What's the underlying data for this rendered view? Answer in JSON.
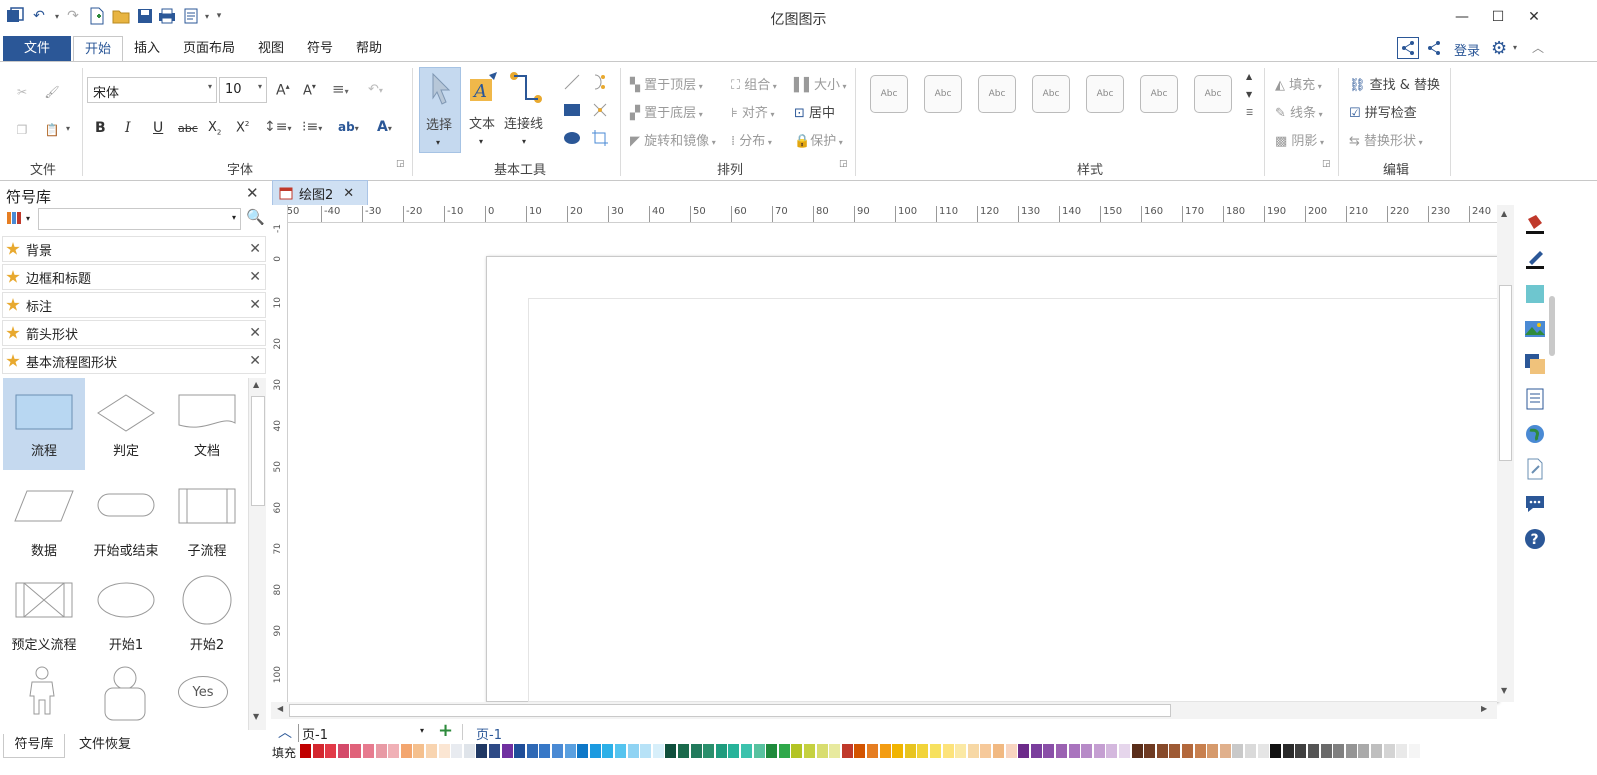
{
  "app": {
    "title": "亿图图示"
  },
  "ribbon_tabs": [
    "文件",
    "开始",
    "插入",
    "页面布局",
    "视图",
    "符号",
    "帮助"
  ],
  "account": {
    "login": "登录"
  },
  "ribbon": {
    "file_group": "文件",
    "font": {
      "family": "宋体",
      "size": "10",
      "group": "字体"
    },
    "tools": {
      "select": "选择",
      "text": "文本",
      "connector": "连接线",
      "group": "基本工具"
    },
    "arrange": {
      "bring_front": "置于顶层",
      "send_back": "置于底层",
      "rotate": "旋转和镜像",
      "group_btn": "组合",
      "align": "对齐",
      "distribute": "分布",
      "size": "大小",
      "center": "居中",
      "protect": "保护",
      "group": "排列"
    },
    "styles": {
      "thumb": "Abc",
      "fill": "填充",
      "line": "线条",
      "shadow": "阴影",
      "group": "样式"
    },
    "edit": {
      "find": "查找 & 替换",
      "spell": "拼写检查",
      "replace": "替换形状",
      "group": "编辑"
    }
  },
  "library": {
    "title": "符号库",
    "categories": [
      "背景",
      "边框和标题",
      "标注",
      "箭头形状",
      "基本流程图形状"
    ],
    "shapes": [
      "流程",
      "判定",
      "文档",
      "数据",
      "开始或结束",
      "子流程",
      "预定义流程",
      "开始1",
      "开始2"
    ],
    "yes_label": "Yes"
  },
  "bottom_tabs": [
    "符号库",
    "文件恢复"
  ],
  "document": {
    "tab": "绘图2"
  },
  "ruler": {
    "top": [
      "-50",
      "-40",
      "-30",
      "-20",
      "-10",
      "0",
      "10",
      "20",
      "30",
      "40",
      "50",
      "60",
      "70",
      "80",
      "90",
      "100",
      "110",
      "120",
      "130",
      "140",
      "150",
      "160",
      "170",
      "180",
      "190",
      "200",
      "210",
      "220",
      "230",
      "240"
    ],
    "left": [
      "-1",
      "0",
      "10",
      "20",
      "30",
      "40",
      "50",
      "60",
      "70",
      "80",
      "90",
      "100"
    ]
  },
  "pages": {
    "current": "页-1",
    "tab": "页-1"
  },
  "fill_label": "填充",
  "palette": [
    "#c00000",
    "#d4272f",
    "#e23a48",
    "#d44a6a",
    "#e0627a",
    "#e77b8f",
    "#e89aa5",
    "#f0b0b6",
    "#f3a66f",
    "#f5c08e",
    "#f8d4b0",
    "#fbe6d3",
    "#e8ebf0",
    "#dfe4ea",
    "#1f3864",
    "#2e4a86",
    "#7030a0",
    "#1f4e99",
    "#2f69b5",
    "#3778c7",
    "#4a8ad4",
    "#5aa0e0",
    "#0e78c8",
    "#1c9ae0",
    "#2cb0e8",
    "#55c4ef",
    "#8fd3f3",
    "#b7e2f7",
    "#d7effa",
    "#0f4f3c",
    "#1a6a4c",
    "#227a5c",
    "#2a8f6c",
    "#1f9c7e",
    "#27b39a",
    "#3cc2ad",
    "#58c2a0",
    "#1f8b3c",
    "#2fa84a",
    "#b3c424",
    "#c5d140",
    "#d8dd6e",
    "#e8ea9f",
    "#c0392b",
    "#d35400",
    "#e67e22",
    "#f39c12",
    "#f1b400",
    "#e8c420",
    "#f2d43a",
    "#f7e15f",
    "#fde37b",
    "#fbe9a5",
    "#f7d8a5",
    "#f6c99a",
    "#f1b982",
    "#f8d5c0",
    "#6c2b8a",
    "#7a3e9d",
    "#8a4fa8",
    "#9b62b2",
    "#a974be",
    "#b78bc8",
    "#c59fd2",
    "#d4b8de",
    "#e6d6ec",
    "#5a2e1a",
    "#6f3b22",
    "#874a2a",
    "#9e5a34",
    "#b3683c",
    "#c8804f",
    "#d69a6c",
    "#e0b08c",
    "#c9c9c9",
    "#dadada",
    "#e5e5e5",
    "#111111",
    "#2b2b2b",
    "#404040",
    "#555555",
    "#6a6a6a",
    "#808080",
    "#959595",
    "#aaaaaa",
    "#bfbfbf",
    "#d4d4d4",
    "#e9e9e9",
    "#f5f5f5"
  ]
}
